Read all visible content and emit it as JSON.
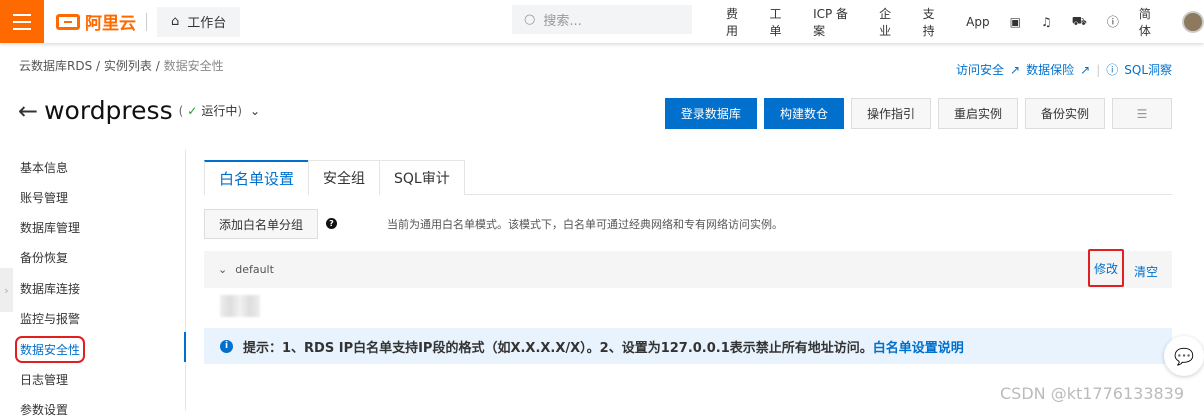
{
  "header": {
    "workbench": "工作台",
    "search_placeholder": "搜索...",
    "nav": [
      "费用",
      "工单",
      "ICP 备案",
      "企业",
      "支持",
      "App"
    ],
    "lang": "简体",
    "logo": "阿里云"
  },
  "breadcrumb": [
    "云数据库RDS",
    "实例列表",
    "数据安全性"
  ],
  "links": {
    "access": "访问安全",
    "protect": "数据保险",
    "sql": "SQL洞察"
  },
  "instance": {
    "name": "wordpress",
    "status": "运行中"
  },
  "actions": [
    "登录数据库",
    "构建数仓",
    "操作指引",
    "重启实例",
    "备份实例"
  ],
  "sidebar": [
    "基本信息",
    "账号管理",
    "数据库管理",
    "备份恢复",
    "数据库连接",
    "监控与报警",
    "数据安全性",
    "日志管理",
    "参数设置"
  ],
  "tabs": [
    "白名单设置",
    "安全组",
    "SQL审计"
  ],
  "add_group": "添加白名单分组",
  "mode_hint": "当前为通用白名单模式。该模式下，白名单可通过经典网络和专有网络访问实例。",
  "group": {
    "name": "default",
    "edit": "修改",
    "clear": "清空"
  },
  "tip": {
    "text": "提示：1、RDS IP白名单支持IP段的格式（如X.X.X.X/X）。2、设置为127.0.0.1表示禁止所有地址访问。",
    "link": "白名单设置说明"
  },
  "watermark": "CSDN @kt1776133839"
}
